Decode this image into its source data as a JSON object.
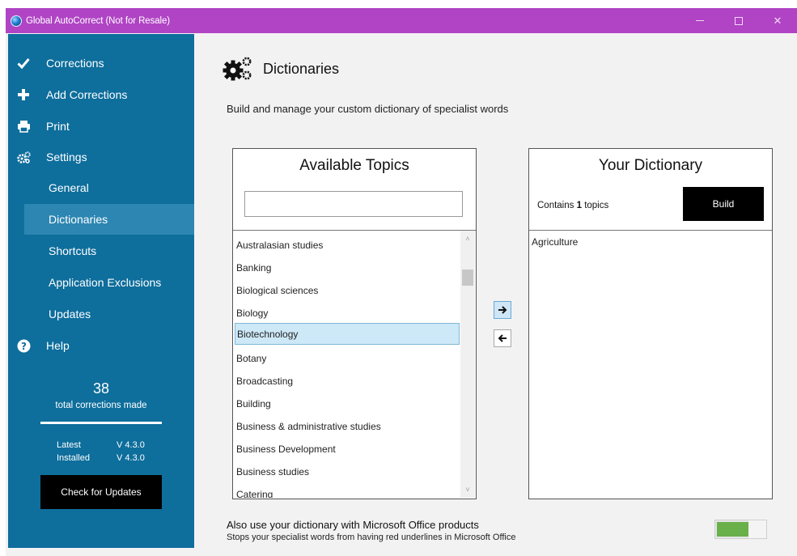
{
  "window": {
    "title": "Global AutoCorrect (Not for Resale)",
    "controls": {
      "minimize": "–",
      "maximize": "□",
      "close": "✕"
    }
  },
  "sidebar": {
    "items": [
      {
        "label": "Corrections",
        "icon": "check-icon"
      },
      {
        "label": "Add Corrections",
        "icon": "plus-icon"
      },
      {
        "label": "Print",
        "icon": "printer-icon"
      },
      {
        "label": "Settings",
        "icon": "gears-icon"
      }
    ],
    "settings_sub": [
      {
        "label": "General"
      },
      {
        "label": "Dictionaries",
        "active": true
      },
      {
        "label": "Shortcuts"
      },
      {
        "label": "Application Exclusions"
      },
      {
        "label": "Updates"
      }
    ],
    "help": {
      "label": "Help",
      "icon": "question-circle-icon"
    },
    "stats": {
      "count": "38",
      "label": "total corrections made"
    },
    "versions": {
      "latest_label": "Latest",
      "latest_value": "V 4.3.0",
      "installed_label": "Installed",
      "installed_value": "V 4.3.0"
    },
    "check_updates_label": "Check for Updates"
  },
  "main": {
    "title": "Dictionaries",
    "subtitle": "Build and manage your custom dictionary of specialist words",
    "available": {
      "title": "Available Topics",
      "search_value": "",
      "topics": [
        "Australasian studies",
        "Banking",
        "Biological sciences",
        "Biology",
        "Biotechnology",
        "Botany",
        "Broadcasting",
        "Building",
        "Business & administrative studies",
        "Business Development",
        "Business studies",
        "Catering"
      ],
      "selected_index": 4,
      "scroll_up": "˄",
      "scroll_down": "˅"
    },
    "transfer": {
      "add": "➔",
      "remove": "🡐"
    },
    "dictionary": {
      "title": "Your Dictionary",
      "contains_prefix": "Contains ",
      "contains_count": "1",
      "contains_suffix": " topics",
      "build_label": "Build",
      "items": [
        "Agriculture"
      ]
    },
    "office": {
      "title": "Also use your dictionary with Microsoft Office products",
      "description": "Stops your specialist words from having red underlines in Microsoft Office",
      "toggle_on": true,
      "toggle_level": 0.68
    },
    "colors": {
      "titlebar": "#b044c5",
      "sidebar": "#0e6e9c",
      "sidebar_active": "#2d86b2",
      "toggle_on": "#69b04a"
    }
  }
}
